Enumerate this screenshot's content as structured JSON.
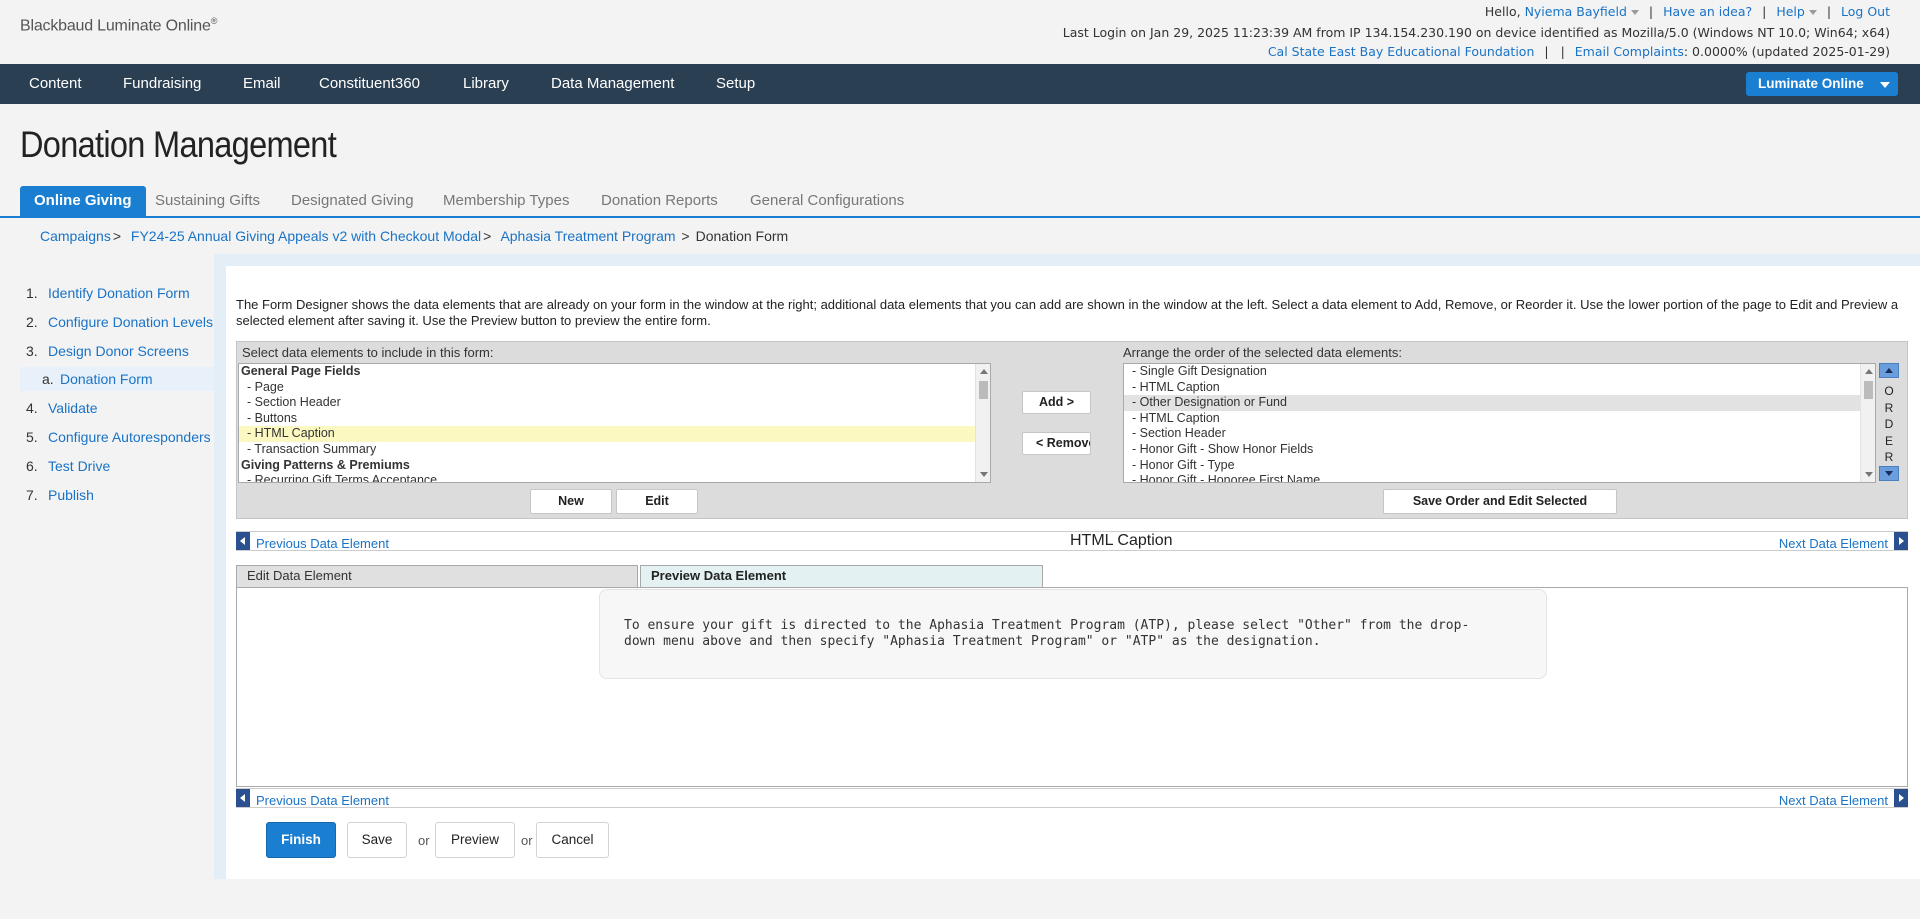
{
  "header": {
    "logo": "Blackbaud Luminate Online",
    "logo_mark": "®",
    "hello": "Hello,",
    "user_name": "Nyiema Bayfield",
    "have_idea": "Have an idea?",
    "help": "Help",
    "logout": "Log Out",
    "last_login": "Last Login on Jan 29, 2025 11:23:39 AM from IP 134.154.230.190 on device identified as Mozilla/5.0 (Windows NT 10.0; Win64; x64)",
    "org_name": "Cal State East Bay Educational Foundation",
    "email_complaints_label": "Email Complaints",
    "email_complaints_value": ": 0.0000% (updated 2025-01-29)"
  },
  "nav": {
    "items": [
      "Content",
      "Fundraising",
      "Email",
      "Constituent360",
      "Library",
      "Data Management",
      "Setup"
    ],
    "product_button": "Luminate Online"
  },
  "page": {
    "title": "Donation Management"
  },
  "tabs": [
    "Online Giving",
    "Sustaining Gifts",
    "Designated Giving",
    "Membership Types",
    "Donation Reports",
    "General Configurations"
  ],
  "breadcrumb": {
    "items": [
      "Campaigns",
      "FY24-25 Annual Giving Appeals v2 with Checkout Modal",
      "Aphasia Treatment Program"
    ],
    "separator": ">",
    "current": "Donation Form"
  },
  "steps": [
    {
      "num": "1.",
      "label": "Identify Donation Form"
    },
    {
      "num": "2.",
      "label": "Configure Donation Levels"
    },
    {
      "num": "3.",
      "label": "Design Donor Screens"
    },
    {
      "num": "a.",
      "label": "Donation Form"
    },
    {
      "num": "4.",
      "label": "Validate"
    },
    {
      "num": "5.",
      "label": "Configure Autoresponders"
    },
    {
      "num": "6.",
      "label": "Test Drive"
    },
    {
      "num": "7.",
      "label": "Publish"
    }
  ],
  "intro": "The Form Designer shows the data elements that are already on your form in the window at the right; additional data elements that you can add are shown in the window at the left. Select a data element to Add, Remove, or Reorder it. Use the lower portion of the page to Edit and Preview a selected element after saving it. Use the Preview button to preview the entire form.",
  "designer": {
    "left_label": "Select data elements to include in this form:",
    "right_label": "Arrange the order of the selected data elements:",
    "available": [
      "General Page Fields",
      " - Page",
      " - Section Header",
      " - Buttons",
      " - HTML Caption",
      " - Transaction Summary",
      "Giving Patterns & Premiums",
      " - Recurring Gift Terms Acceptance"
    ],
    "selected": [
      " - Single Gift Designation",
      " - HTML Caption",
      " - Other Designation or Fund",
      " - HTML Caption",
      " - Section Header",
      " - Honor Gift - Show Honor Fields",
      " - Honor Gift - Type",
      " - Honor Gift - Honoree First Name"
    ],
    "add_button": "Add >",
    "remove_button": "< Remove",
    "new_button": "New",
    "edit_button": "Edit",
    "save_order_button": "Save Order and Edit Selected",
    "order_letters": [
      "O",
      "R",
      "D",
      "E",
      "R"
    ]
  },
  "element_nav": {
    "prev": "Previous Data Element",
    "next": "Next Data Element",
    "title": "HTML Caption"
  },
  "element_tabs": {
    "edit": "Edit Data Element",
    "preview": "Preview Data Element"
  },
  "preview": {
    "text": "To ensure your gift is directed to the Aphasia Treatment Program (ATP), please select \"Other\" from the drop-down menu above and then specify \"Aphasia Treatment Program\" or \"ATP\" as the designation."
  },
  "actions": {
    "finish": "Finish",
    "save": "Save",
    "or": "or",
    "preview": "Preview",
    "cancel": "Cancel"
  }
}
